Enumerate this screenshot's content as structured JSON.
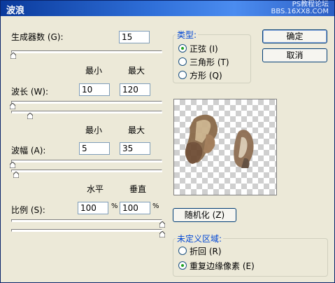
{
  "window": {
    "title": "波浪",
    "watermark_line1": "PS教程论坛",
    "watermark_line2": "BBS.16XX8.COM"
  },
  "generators": {
    "label": "生成器数 (G):",
    "value": "15"
  },
  "col_headers": {
    "min": "最小",
    "max": "最大"
  },
  "wavelength": {
    "label": "波长 (W):",
    "min": "10",
    "max": "120"
  },
  "amplitude": {
    "label": "波幅 (A):",
    "min": "5",
    "max": "35"
  },
  "scale_headers": {
    "horizontal": "水平",
    "vertical": "垂直"
  },
  "scale": {
    "label": "比例 (S):",
    "horizontal": "100",
    "vertical": "100",
    "unit": "%"
  },
  "type_group": {
    "title": "类型:",
    "options": [
      {
        "label": "正弦 (I)",
        "selected": true
      },
      {
        "label": "三角形 (T)",
        "selected": false
      },
      {
        "label": "方形 (Q)",
        "selected": false
      }
    ]
  },
  "buttons": {
    "ok": "确定",
    "cancel": "取消",
    "randomize": "随机化 (Z)"
  },
  "undefined_group": {
    "title": "未定义区域:",
    "options": [
      {
        "label": "折回 (R)",
        "selected": false
      },
      {
        "label": "重复边缘像素 (E)",
        "selected": true
      }
    ]
  },
  "colors": {
    "accent": "#0046d5",
    "title_bar": "#2f6fd8",
    "radio_selected": "#21a121"
  }
}
